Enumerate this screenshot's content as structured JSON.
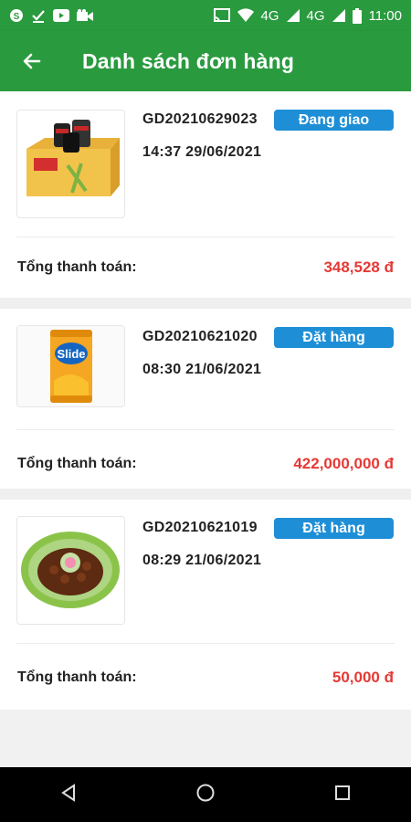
{
  "status_bar": {
    "time": "11:00",
    "network_1": "4G",
    "network_2": "4G"
  },
  "header": {
    "title": "Danh sách đơn hàng",
    "background": "#2a9a3f"
  },
  "orders": [
    {
      "id": "GD20210629023",
      "time": "14:37 29/06/2021",
      "status": "Đang giao",
      "total_label": "Tổng thanh toán:",
      "total": "348,528 đ",
      "image": "snack-cup-box"
    },
    {
      "id": "GD20210621020",
      "time": "08:30 21/06/2021",
      "status": "Đặt hàng",
      "total_label": "Tổng thanh toán:",
      "total": "422,000,000 đ",
      "image": "chips-can"
    },
    {
      "id": "GD20210621019",
      "time": "08:29 21/06/2021",
      "status": "Đặt hàng",
      "total_label": "Tổng thanh toán:",
      "total": "50,000 đ",
      "image": "vegetable-dish"
    }
  ],
  "colors": {
    "badge": "#1e8fd6",
    "price": "#e53935"
  }
}
